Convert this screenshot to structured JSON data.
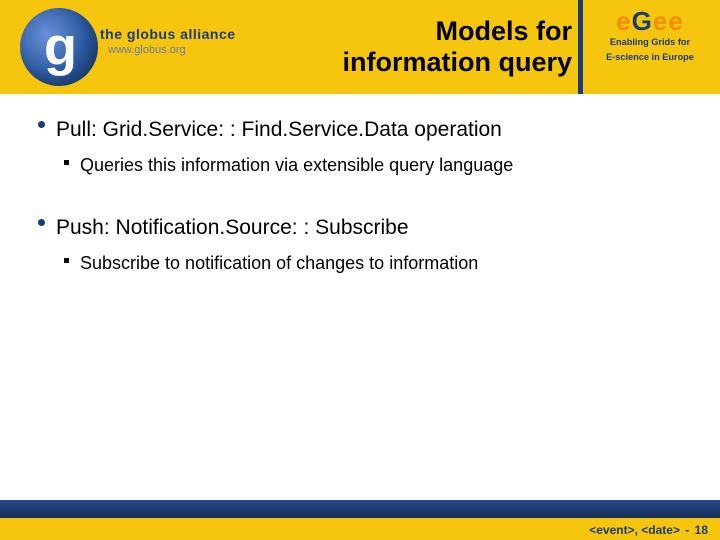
{
  "header": {
    "globus": {
      "g": "g",
      "line1": "the globus alliance",
      "line2": "www.globus.org"
    },
    "title": {
      "line1": "Models for",
      "line2": "information query"
    },
    "egee": {
      "e1": "e",
      "g": "G",
      "e2": "e",
      "e3": "e",
      "sub1": "Enabling Grids for",
      "sub2": "E-science in Europe"
    }
  },
  "content": {
    "b1": "Pull: Grid.Service: : Find.Service.Data operation",
    "b1s1": "Queries this information via extensible query language",
    "b2": "Push: Notification.Source: : Subscribe",
    "b2s1": "Subscribe to notification of changes to information"
  },
  "footer": {
    "event": "<event>, <date>",
    "dash": " - ",
    "page": "18"
  }
}
